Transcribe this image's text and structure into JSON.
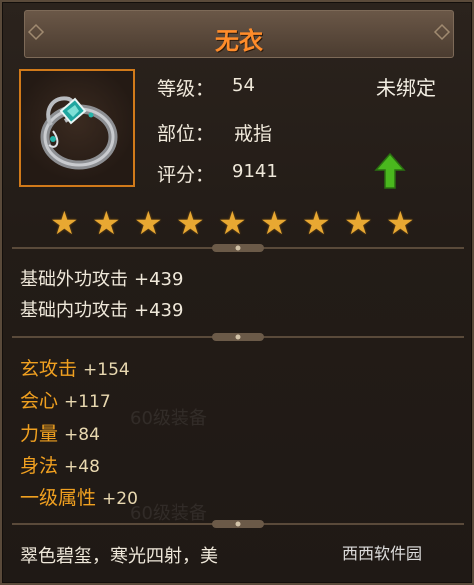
{
  "title": "无衣",
  "stats": {
    "level_label": "等级：",
    "level_value": "54",
    "slot_label": "部位：",
    "slot_value": "戒指",
    "score_label": "评分：",
    "score_value": "9141",
    "bind_status": "未绑定"
  },
  "star_count": 9,
  "base_stats": [
    {
      "name": "基础外功攻击",
      "value": "+439"
    },
    {
      "name": "基础内功攻击",
      "value": "+439"
    }
  ],
  "bonus_stats": [
    {
      "name": "玄攻击",
      "value": "+154"
    },
    {
      "name": "会心",
      "value": "+117"
    },
    {
      "name": "力量",
      "value": "+84"
    },
    {
      "name": "身法",
      "value": "+48"
    },
    {
      "name": "一级属性",
      "value": "+20"
    }
  ],
  "flavor_text": "翠色碧玺，寒光四射，美",
  "background_text": [
    "60级装备",
    "60级装备"
  ],
  "watermark": "西西软件园",
  "colors": {
    "title": "#ff8c2a",
    "bonus_name": "#f0a020",
    "star": "#e8a832",
    "upgrade_arrow": "#4ab81e",
    "item_frame": "#d17a1a"
  },
  "icons": {
    "item": "jade-ring-icon",
    "upgrade": "green-up-arrow-icon",
    "star": "star-icon"
  }
}
